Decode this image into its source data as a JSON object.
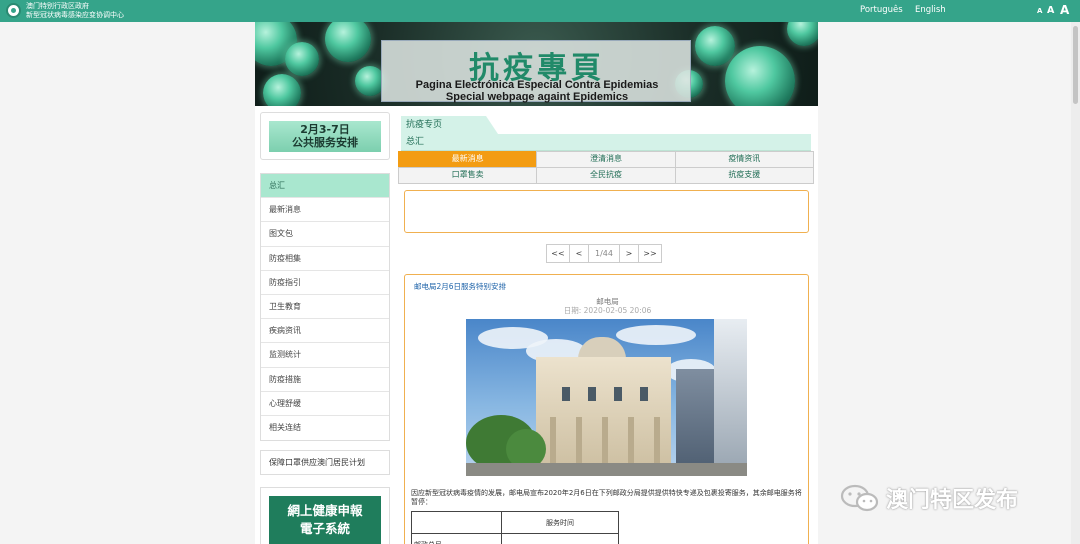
{
  "topbar": {
    "org_line1": "澳门特别行政区政府",
    "org_line2": "新型冠状病毒感染应变协调中心",
    "lang_pt": "Português",
    "lang_en": "English",
    "font_small": "A",
    "font_medium": "A",
    "font_large": "A"
  },
  "banner": {
    "title": "抗疫專頁",
    "subtitle_pt": "Pagina Electrónica Especial Contra Epidemias",
    "subtitle_en": "Special webpage againt Epidemics"
  },
  "sidebar": {
    "promo_line1": "2月3-7日",
    "promo_line2": "公共服务安排",
    "items": [
      {
        "label": "总汇",
        "active": true
      },
      {
        "label": "最新消息"
      },
      {
        "label": "图文包"
      },
      {
        "label": "防疫相集"
      },
      {
        "label": "防疫指引"
      },
      {
        "label": "卫生教育"
      },
      {
        "label": "疾病资讯"
      },
      {
        "label": "监测统计"
      },
      {
        "label": "防疫措施"
      },
      {
        "label": "心理舒缓"
      },
      {
        "label": "相关连结"
      }
    ],
    "extra_link": "保障口罩供应澳门居民计划",
    "health_line1": "網上健康申報",
    "health_line2": "電子系統"
  },
  "main": {
    "tab_head": "抗疫专页",
    "section": "总汇",
    "tabs_row1": [
      {
        "label": "最新消息",
        "active": true
      },
      {
        "label": "澄清消息"
      },
      {
        "label": "疫情资讯"
      }
    ],
    "tabs_row2": [
      {
        "label": "口罩售卖"
      },
      {
        "label": "全民抗疫"
      },
      {
        "label": "抗疫支援"
      }
    ],
    "pager": {
      "first": "<<",
      "prev": "<",
      "page": "1/44",
      "next": ">",
      "last": ">>"
    },
    "article": {
      "title": "邮电局2月6日服务特别安排",
      "dept": "邮电局",
      "date": "日期: 2020-02-05 20:06",
      "body": "因应新型冠状病毒疫情的发展，邮电局宣布2020年2月6日在下列邮政分局提供提供特快专递及包裹投寄服务，其余邮电服务将暂停：",
      "table_header": "服务时间",
      "table_row1": "邮政总局"
    }
  },
  "watermark": {
    "text": "澳门特区发布",
    "icon": "wechat-icon"
  },
  "colors": {
    "brand": "#35a48a",
    "accent": "#f39c12",
    "mint": "#a9e7cf"
  }
}
